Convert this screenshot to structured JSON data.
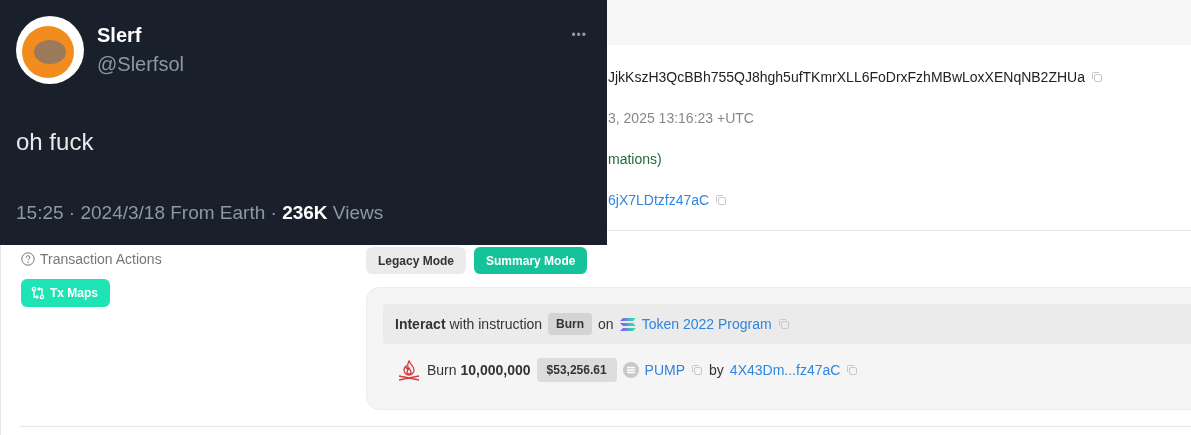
{
  "details": [
    {
      "kind": "hash",
      "text": "JjkKszH3QcBBh755QJ8hgh5ufTKmrXLL6FoDrxFzhMBwLoxXENqNB2ZHUa"
    },
    {
      "kind": "time",
      "text": "3, 2025 13:16:23 +UTC"
    },
    {
      "kind": "status",
      "text": "mations)"
    },
    {
      "kind": "link",
      "text": "6jX7LDtzfz47aC"
    }
  ],
  "actions": {
    "label": "Transaction Actions",
    "tx_maps": "Tx Maps",
    "modes": [
      {
        "label": "Legacy Mode",
        "selected": false
      },
      {
        "label": "Summary Mode",
        "selected": true
      }
    ],
    "interact": {
      "lead": "**Interact** with instruction",
      "instruction": "Burn",
      "on": "on",
      "program": "Token 2022 Program"
    },
    "burn": {
      "text": "Burn **10,000,000**",
      "value": "$53,256.61",
      "token": "PUMP",
      "by": "by",
      "account": "4X43Dm...fz47aC"
    }
  },
  "tweet": {
    "name": "Slerf",
    "handle": "@Slerfsol",
    "more": "•••",
    "text": "oh fuck",
    "meta": "15:25 · 2024/3/18 From Earth · **236K** Views"
  }
}
